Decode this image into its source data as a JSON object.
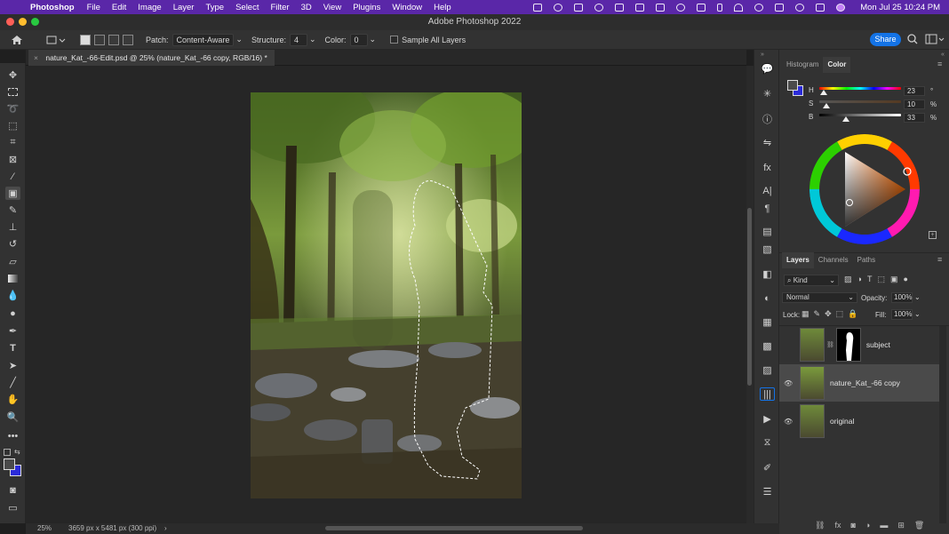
{
  "menubar": {
    "app": "Photoshop",
    "items": [
      "File",
      "Edit",
      "Image",
      "Layer",
      "Type",
      "Select",
      "Filter",
      "3D",
      "View",
      "Plugins",
      "Window",
      "Help"
    ],
    "clock": "Mon Jul 25  10:24 PM"
  },
  "window": {
    "title": "Adobe Photoshop 2022"
  },
  "options": {
    "patch_label": "Patch:",
    "patch_value": "Content-Aware",
    "structure_label": "Structure:",
    "structure_value": "4",
    "color_label": "Color:",
    "color_value": "0",
    "sample_all": "Sample All Layers",
    "share": "Share"
  },
  "document": {
    "tab": "nature_Kat_-66-Edit.psd @ 25% (nature_Kat_-66 copy, RGB/16) *"
  },
  "status": {
    "zoom": "25%",
    "dimensions": "3659 px x 5481 px (300 ppi)"
  },
  "color_panel": {
    "tabs": [
      "Histogram",
      "Color"
    ],
    "active": "Color",
    "h_label": "H",
    "h": "23",
    "h_unit": "°",
    "s_label": "S",
    "s": "10",
    "s_unit": "%",
    "b_label": "B",
    "b": "33",
    "b_unit": "%"
  },
  "layers_panel": {
    "tabs": [
      "Layers",
      "Channels",
      "Paths"
    ],
    "filter": "Kind",
    "blend": "Normal",
    "opacity_label": "Opacity:",
    "opacity": "100%",
    "lock_label": "Lock:",
    "fill_label": "Fill:",
    "fill": "100%",
    "layers": [
      {
        "name": "subject",
        "visible": false,
        "selected": false
      },
      {
        "name": "nature_Kat_-66 copy",
        "visible": true,
        "selected": true
      },
      {
        "name": "original",
        "visible": true,
        "selected": false
      }
    ]
  },
  "colors": {
    "menubar": "#5a27a8",
    "accent": "#1473e6",
    "foreground": "#2b2bd9"
  }
}
